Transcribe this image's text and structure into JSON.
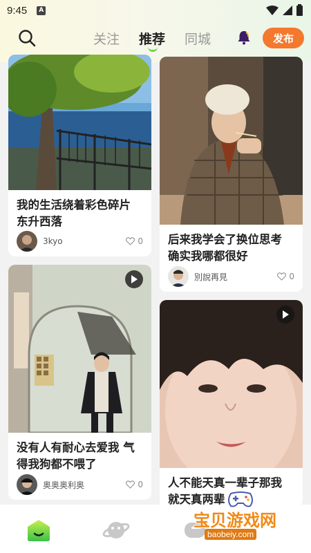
{
  "status_bar": {
    "time": "9:45",
    "notif_glyph": "A"
  },
  "header": {
    "tabs": [
      {
        "label": "关注",
        "active": false
      },
      {
        "label": "推荐",
        "active": true
      },
      {
        "label": "同城",
        "active": false
      }
    ],
    "publish_label": "发布",
    "accent": "#f4782d",
    "active_underline_color": "#6fd24a"
  },
  "feed": {
    "left": [
      {
        "title_line1": "我的生活绕着彩色碎片",
        "title_line2": "东升西落",
        "author": "3kyo",
        "likes": "0",
        "video": false
      },
      {
        "title_line1": "没有人有耐心去爱我 气",
        "title_line2": "得我狗都不喂了",
        "author": "奥奥奥利奥",
        "likes": "0",
        "video": true
      }
    ],
    "right": [
      {
        "title_line1": "后来我学会了换位思考",
        "title_line2": "确实我哪都很好",
        "author": "別說再見",
        "likes": "0",
        "video": false
      },
      {
        "title_line1": "人不能天真一辈子那我",
        "title_line2": "就天真两辈",
        "video": true
      }
    ]
  },
  "bottom_nav": {
    "items": [
      "home-icon",
      "planet-icon",
      "chat-icon"
    ]
  },
  "watermark": {
    "text": "宝贝游戏网",
    "url": "baobeiy.com"
  }
}
